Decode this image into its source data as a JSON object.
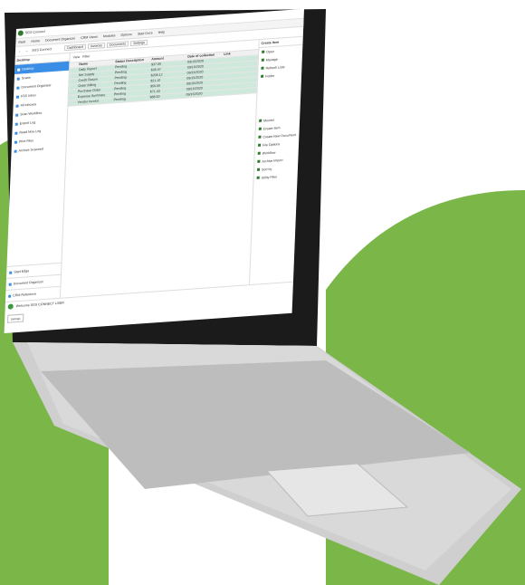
{
  "app": {
    "title": "SGS Connect"
  },
  "menu": [
    "Back",
    "Home",
    "Document Organizer",
    "CRM Views",
    "Modules",
    "Options",
    "Start Docs",
    "Help"
  ],
  "nav": {
    "location": "SGS Connect",
    "tabs": [
      "Dashboard",
      "Invoices",
      "Documents",
      "Settings"
    ]
  },
  "sidebar": {
    "header": "Desktop",
    "items": [
      "Desktop",
      "Scans",
      "Document Organizer",
      "FSS Inbox",
      "All Inboxes",
      "Scan Workflow",
      "Export Log",
      "Read Now Log",
      "Print Files",
      "Archive Scanned"
    ],
    "bottom": [
      "Start Edge",
      "Document Organizer",
      "CRM Reference"
    ]
  },
  "main": {
    "toolbar": [
      "View",
      "Filter"
    ],
    "columns": [
      "",
      "Name",
      "Status Description",
      "Amount",
      "Date of collection",
      "Link"
    ],
    "rows": [
      [
        "",
        "Daily Report",
        "Pending",
        "$37.00",
        "09/15/2020",
        ""
      ],
      [
        "",
        "Net Supply",
        "Pending",
        "$35.07",
        "09/15/2020",
        ""
      ],
      [
        "",
        "Credit Return",
        "Pending",
        "$208.12",
        "09/15/2020",
        ""
      ],
      [
        "",
        "Order Billing",
        "Pending",
        "$21.10",
        "09/15/2020",
        ""
      ],
      [
        "",
        "Purchase Order",
        "Pending",
        "$50.00",
        "09/15/2020",
        ""
      ],
      [
        "",
        "Expense Summary",
        "Pending",
        "$71.33",
        "09/15/2020",
        ""
      ],
      [
        "",
        "Vendor Invoice",
        "Pending",
        "$88.50",
        "09/15/2020",
        ""
      ]
    ]
  },
  "rightpane": {
    "header": "Create Item",
    "items_top": [
      "Open",
      "Manage",
      "Refresh Lists",
      "Folder"
    ],
    "items_bottom": [
      "Monitor",
      "Create Item",
      "Create New Document",
      "File Options",
      "Workflow",
      "Archive Import",
      "Sort by",
      "Utility Files"
    ]
  },
  "status": {
    "text": "Welcome SGS CONNECT USER",
    "button": "Settings"
  }
}
